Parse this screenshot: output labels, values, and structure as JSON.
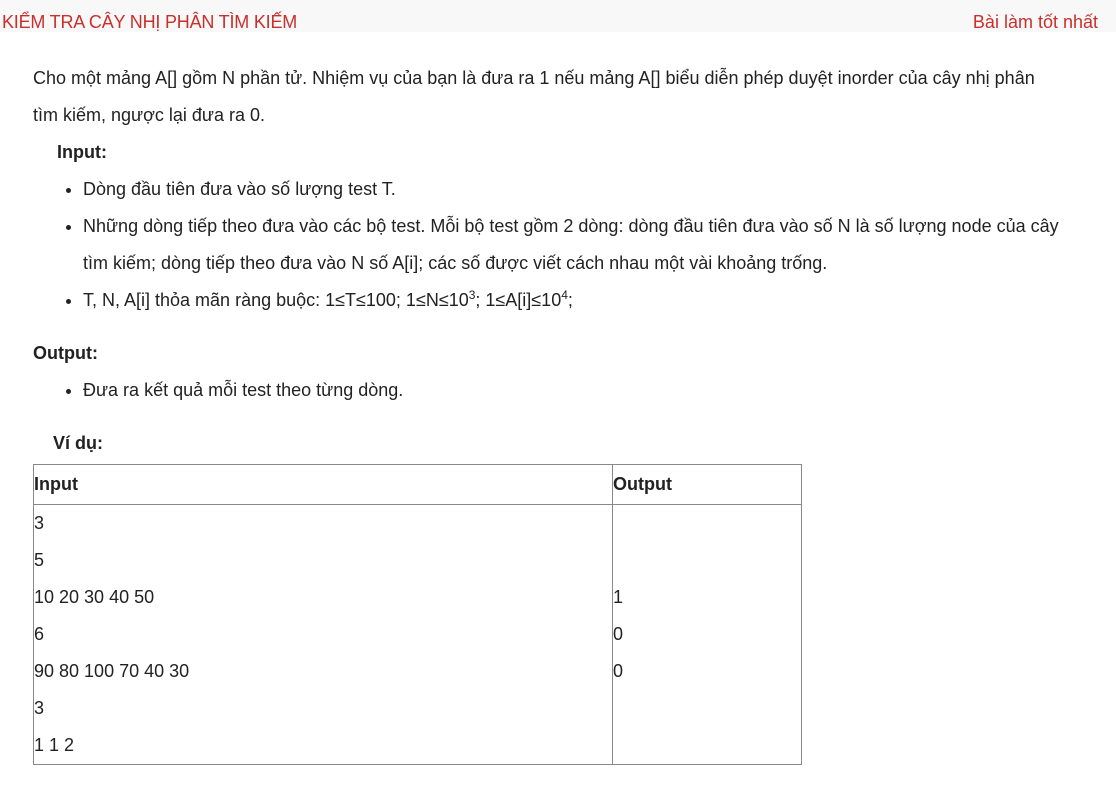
{
  "header": {
    "title": "KIỂM TRA CÂY NHỊ PHÂN TÌM KIẾM",
    "best_link": "Bài làm tốt nhất"
  },
  "description": {
    "line1": "Cho một mảng A[] gồm N phần tử. Nhiệm vụ của bạn là đưa ra 1 nếu mảng A[] biểu diễn phép duyệt inorder của cây nhị phân",
    "line2": "tìm kiếm, ngược lại đưa ra 0."
  },
  "input_section": {
    "label": "Input:",
    "items": [
      "Dòng đầu tiên đưa vào số lượng test T.",
      "Những dòng tiếp theo đưa vào các bộ test. Mỗi bộ test gồm 2 dòng: dòng đầu tiên đưa vào số N là số lượng node của cây",
      "tìm kiếm; dòng tiếp theo đưa vào N số A[i]; các số được viết cách nhau một vài khoảng trống."
    ],
    "constraint": {
      "prefix": "T, N, A[i] thỏa mãn ràng buộc: 1≤T≤100; 1≤N≤10",
      "exp1": "3",
      "middle": "; 1≤A[i]≤10",
      "exp2": "4",
      "suffix": ";"
    }
  },
  "output_section": {
    "label": "Output:",
    "items": [
      "Đưa ra kết quả mỗi test theo từng dòng."
    ]
  },
  "example": {
    "label": "Ví dụ:",
    "headers": [
      "Input",
      "Output"
    ],
    "input_lines": [
      "3",
      "5",
      "10 20 30 40 50",
      "6",
      "90 80 100 70 40 30",
      "3",
      "1 1 2"
    ],
    "output_lines": [
      "",
      "",
      "1",
      "0",
      "0",
      "",
      ""
    ]
  }
}
